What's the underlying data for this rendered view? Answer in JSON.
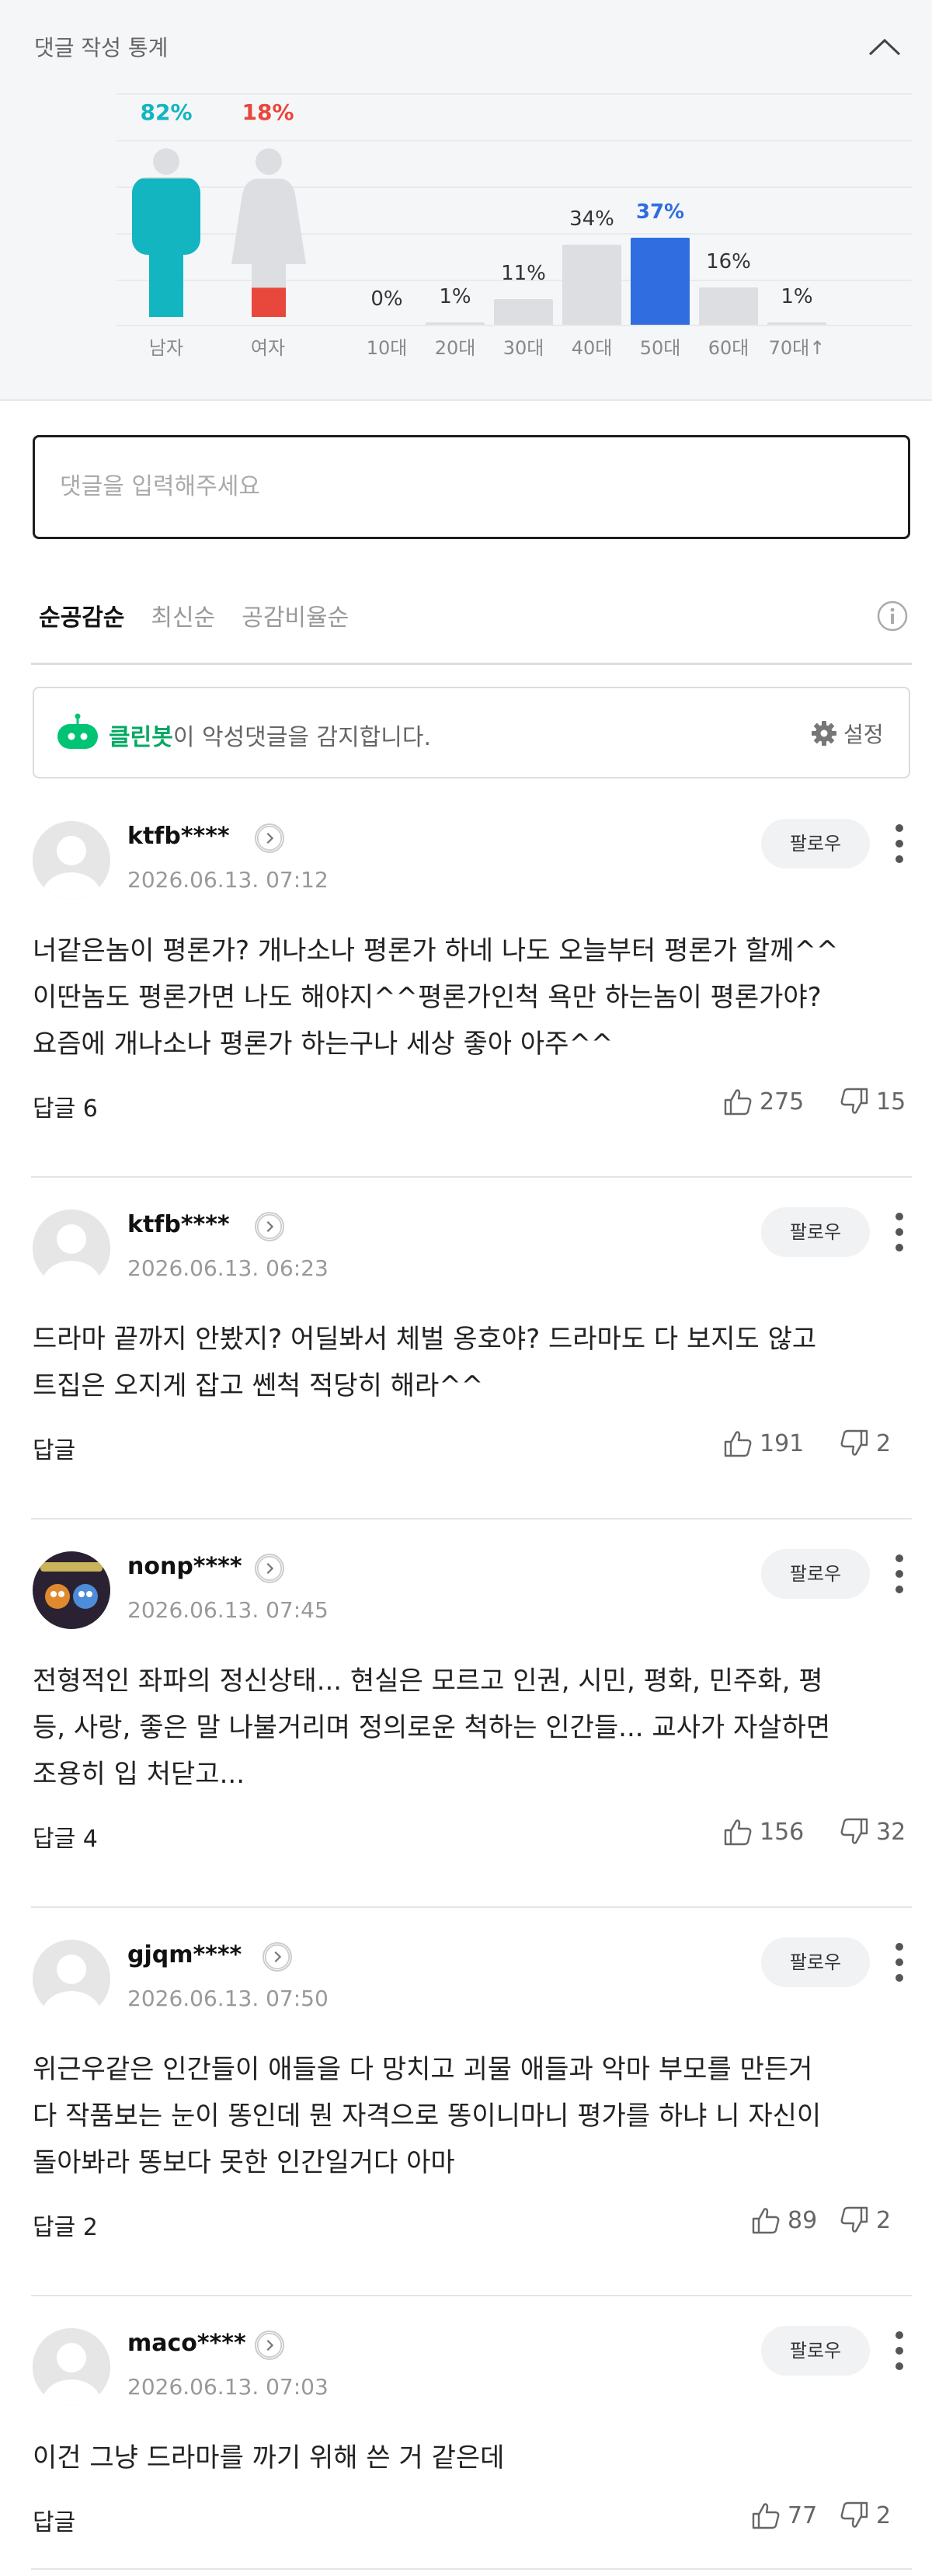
{
  "stats": {
    "title": "댓글 작성 통계",
    "gender": [
      {
        "label": "남자",
        "percent": "82%",
        "value": 82,
        "color": "#13b5c1"
      },
      {
        "label": "여자",
        "percent": "18%",
        "value": 18,
        "color": "#e8473c"
      }
    ],
    "ages": [
      {
        "label": "10대",
        "percent": "0%",
        "value": 0,
        "highlight": false
      },
      {
        "label": "20대",
        "percent": "1%",
        "value": 1,
        "highlight": false
      },
      {
        "label": "30대",
        "percent": "11%",
        "value": 11,
        "highlight": false
      },
      {
        "label": "40대",
        "percent": "34%",
        "value": 34,
        "highlight": false
      },
      {
        "label": "50대",
        "percent": "37%",
        "value": 37,
        "highlight": true
      },
      {
        "label": "60대",
        "percent": "16%",
        "value": 16,
        "highlight": false
      },
      {
        "label": "70대↑",
        "percent": "1%",
        "value": 1,
        "highlight": false
      }
    ],
    "accent_color": "#2f6de1"
  },
  "input": {
    "placeholder": "댓글을 입력해주세요"
  },
  "sort": {
    "tabs": [
      "순공감순",
      "최신순",
      "공감비율순"
    ],
    "active_index": 0
  },
  "cleanbot": {
    "brand": "클린봇",
    "message": "이 악성댓글을 감지합니다.",
    "settings_label": "설정"
  },
  "follow_label": "팔로우",
  "comments": [
    {
      "username": "ktfb****",
      "timestamp": "2026.06.13. 07:12",
      "text": "너같은놈이 평론가? 개나소나 평론가 하네 나도 오늘부터 평론가 할께^^\n이딴놈도 평론가면 나도 해야지^^평론가인척 욕만 하는놈이 평론가야?\n요즘에 개나소나 평론가 하는구나 세상 좋아 아주^^",
      "reply": "답글 6",
      "likes": "275",
      "dislikes": "15"
    },
    {
      "username": "ktfb****",
      "timestamp": "2026.06.13. 06:23",
      "text": "드라마 끝까지 안봤지? 어딜봐서 체벌 옹호야? 드라마도 다 보지도 않고\n트집은 오지게 잡고 쎈척 적당히 해라^^",
      "reply": "답글",
      "likes": "191",
      "dislikes": "2"
    },
    {
      "username": "nonp****",
      "timestamp": "2026.06.13. 07:45",
      "text": "전형적인 좌파의 정신상태... 현실은 모르고 인권, 시민, 평화, 민주화, 평\n등, 사랑, 좋은 말 나불거리며 정의로운 척하는 인간들... 교사가 자살하면\n조용히 입 처닫고...",
      "reply": "답글 4",
      "likes": "156",
      "dislikes": "32"
    },
    {
      "username": "gjqm****",
      "timestamp": "2026.06.13. 07:50",
      "text": "위근우같은 인간들이 애들을 다 망치고 괴물 애들과 악마 부모를 만든거\n다 작품보는 눈이 똥인데 뭔 자격으로 똥이니마니 평가를 하냐 니 자신이\n돌아봐라 똥보다 못한 인간일거다 아마",
      "reply": "답글 2",
      "likes": "89",
      "dislikes": "2"
    },
    {
      "username": "maco****",
      "timestamp": "2026.06.13. 07:03",
      "text": "이건 그냥 드라마를 까기 위해 쓴 거 같은데",
      "reply": "답글",
      "likes": "77",
      "dislikes": "2"
    }
  ]
}
